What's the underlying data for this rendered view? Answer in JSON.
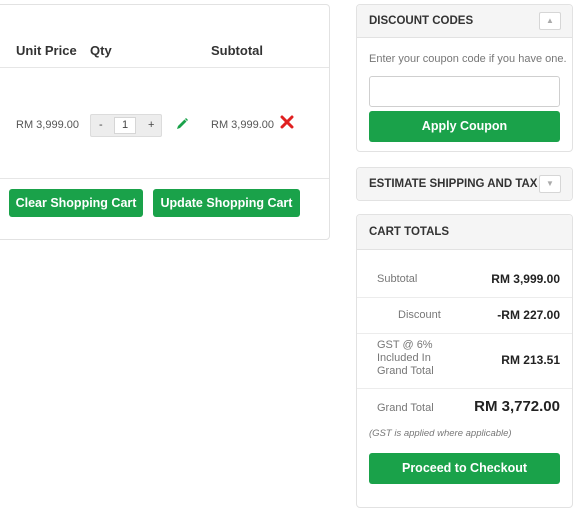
{
  "cart": {
    "headers": {
      "unit_price": "Unit Price",
      "qty": "Qty",
      "subtotal": "Subtotal"
    },
    "item": {
      "unit_price": "RM 3,999.00",
      "qty_minus": "-",
      "qty_value": "1",
      "qty_plus": "+",
      "subtotal": "RM 3,999.00"
    },
    "buttons": {
      "clear": "Clear Shopping Cart",
      "update": "Update Shopping Cart"
    }
  },
  "discount_codes": {
    "title": "DISCOUNT CODES",
    "hint": "Enter your coupon code if you have one.",
    "input_value": "",
    "apply_button": "Apply Coupon",
    "toggle_icon": "chevron-up-icon"
  },
  "estimate_shipping": {
    "title": "ESTIMATE SHIPPING AND TAX",
    "toggle_icon": "chevron-down-icon"
  },
  "cart_totals": {
    "title": "CART TOTALS",
    "subtotal_label": "Subtotal",
    "subtotal_value": "RM 3,999.00",
    "discount_label": "Discount",
    "discount_value": "-RM 227.00",
    "gst_line1": "GST @ 6%",
    "gst_line2": "Included In",
    "gst_line3": "Grand Total",
    "gst_value": "RM 213.51",
    "grand_total_label": "Grand Total",
    "grand_total_value": "RM 3,772.00",
    "gst_note": "(GST is applied where applicable)",
    "checkout_button": "Proceed to Checkout"
  },
  "colors": {
    "primary_green": "#1aa24a",
    "delete_red": "#e02020",
    "edit_green": "#1aa24a"
  }
}
